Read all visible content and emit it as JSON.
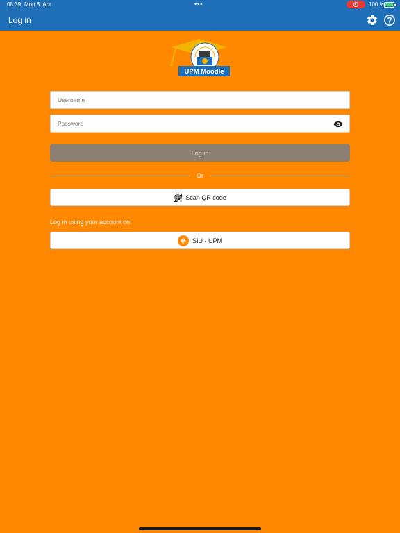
{
  "status_bar": {
    "time": "08:39",
    "date": "Mon 8. Apr",
    "dots": "•••",
    "battery_percent": "100 %"
  },
  "header": {
    "title": "Log in",
    "settings_icon": "gear-icon",
    "help_icon": "question-circle-icon"
  },
  "logo": {
    "brand": "UPM Moodle",
    "seal_text": "RSIDAD POLITEC"
  },
  "form": {
    "username_placeholder": "Username",
    "password_placeholder": "Password",
    "login_label": "Log in",
    "or_label": "Or",
    "qr_label": "Scan QR code",
    "account_label": "Log in using your account on:",
    "siu_label": "SIU - UPM"
  },
  "colors": {
    "background": "#ff8800",
    "header": "#1f6fb8",
    "login_button": "#8b7f72"
  }
}
